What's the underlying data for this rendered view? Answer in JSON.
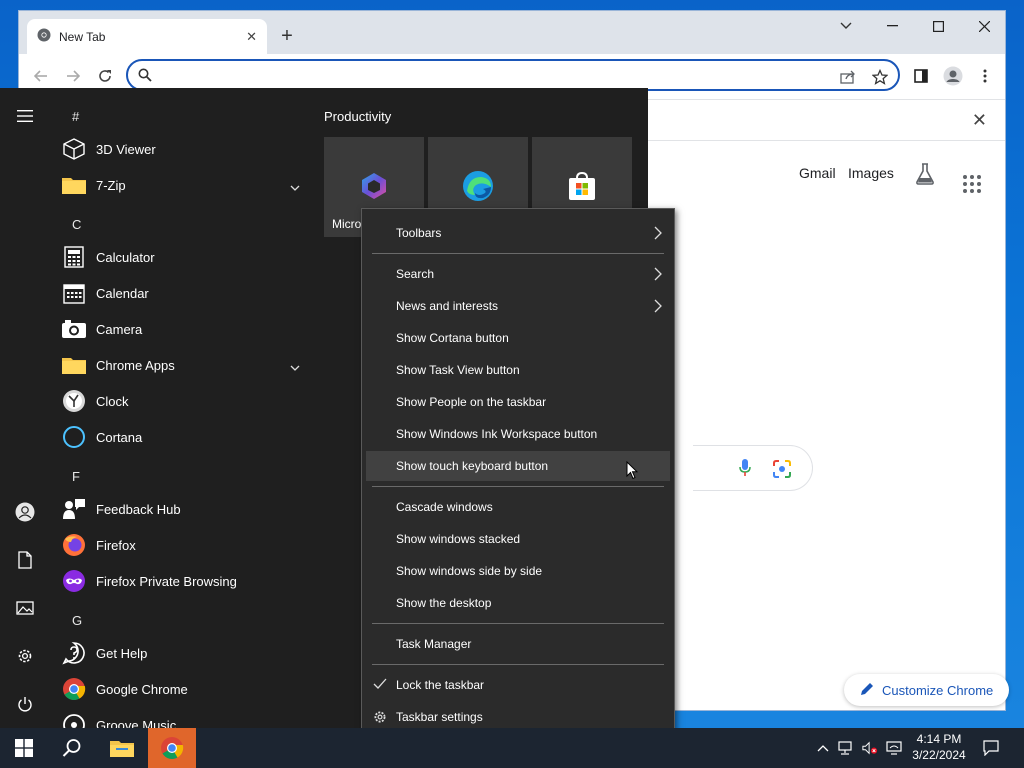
{
  "browser": {
    "tab_title": "New Tab",
    "address_placeholder": "",
    "links": {
      "gmail": "Gmail",
      "images": "Images"
    },
    "customize_label": "Customize Chrome"
  },
  "start_menu": {
    "letters": {
      "hash": "#",
      "c": "C",
      "f": "F",
      "g": "G"
    },
    "apps": [
      {
        "label": "3D Viewer",
        "icon": "cube-icon"
      },
      {
        "label": "7-Zip",
        "icon": "folder-icon",
        "expandable": true
      },
      {
        "label": "Calculator",
        "icon": "calculator-icon"
      },
      {
        "label": "Calendar",
        "icon": "calendar-icon"
      },
      {
        "label": "Camera",
        "icon": "camera-icon"
      },
      {
        "label": "Chrome Apps",
        "icon": "folder-icon",
        "expandable": true
      },
      {
        "label": "Clock",
        "icon": "clock-icon"
      },
      {
        "label": "Cortana",
        "icon": "cortana-icon"
      },
      {
        "label": "Feedback Hub",
        "icon": "feedback-hub-icon"
      },
      {
        "label": "Firefox",
        "icon": "firefox-icon"
      },
      {
        "label": "Firefox Private Browsing",
        "icon": "firefox-private-icon"
      },
      {
        "label": "Get Help",
        "icon": "get-help-icon"
      },
      {
        "label": "Google Chrome",
        "icon": "chrome-icon"
      },
      {
        "label": "Groove Music",
        "icon": "music-icon"
      }
    ],
    "group_title": "Productivity",
    "tiles": [
      {
        "label": "Micro",
        "icon": "microsoft-365-icon"
      },
      {
        "label": "",
        "icon": "edge-icon"
      },
      {
        "label": "",
        "icon": "store-icon"
      }
    ]
  },
  "context_menu": {
    "items": [
      {
        "label": "Toolbars",
        "submenu": true
      },
      {
        "label": "Search",
        "submenu": true
      },
      {
        "label": "News and interests",
        "submenu": true
      },
      {
        "label": "Show Cortana button"
      },
      {
        "label": "Show Task View button"
      },
      {
        "label": "Show People on the taskbar"
      },
      {
        "label": "Show Windows Ink Workspace button"
      },
      {
        "label": "Show touch keyboard button",
        "hovered": true
      },
      {
        "label": "Cascade windows"
      },
      {
        "label": "Show windows stacked"
      },
      {
        "label": "Show windows side by side"
      },
      {
        "label": "Show the desktop"
      },
      {
        "label": "Task Manager"
      },
      {
        "label": "Lock the taskbar",
        "checked": true
      },
      {
        "label": "Taskbar settings",
        "icon": "gear-icon"
      }
    ]
  },
  "taskbar": {
    "time": "4:14 PM",
    "date": "3/22/2024"
  },
  "colors": {
    "accent": "#1a56b8",
    "taskbar_active": "#e0662b",
    "menu_bg": "#2b2b2b",
    "start_bg": "#1f1f1f"
  }
}
